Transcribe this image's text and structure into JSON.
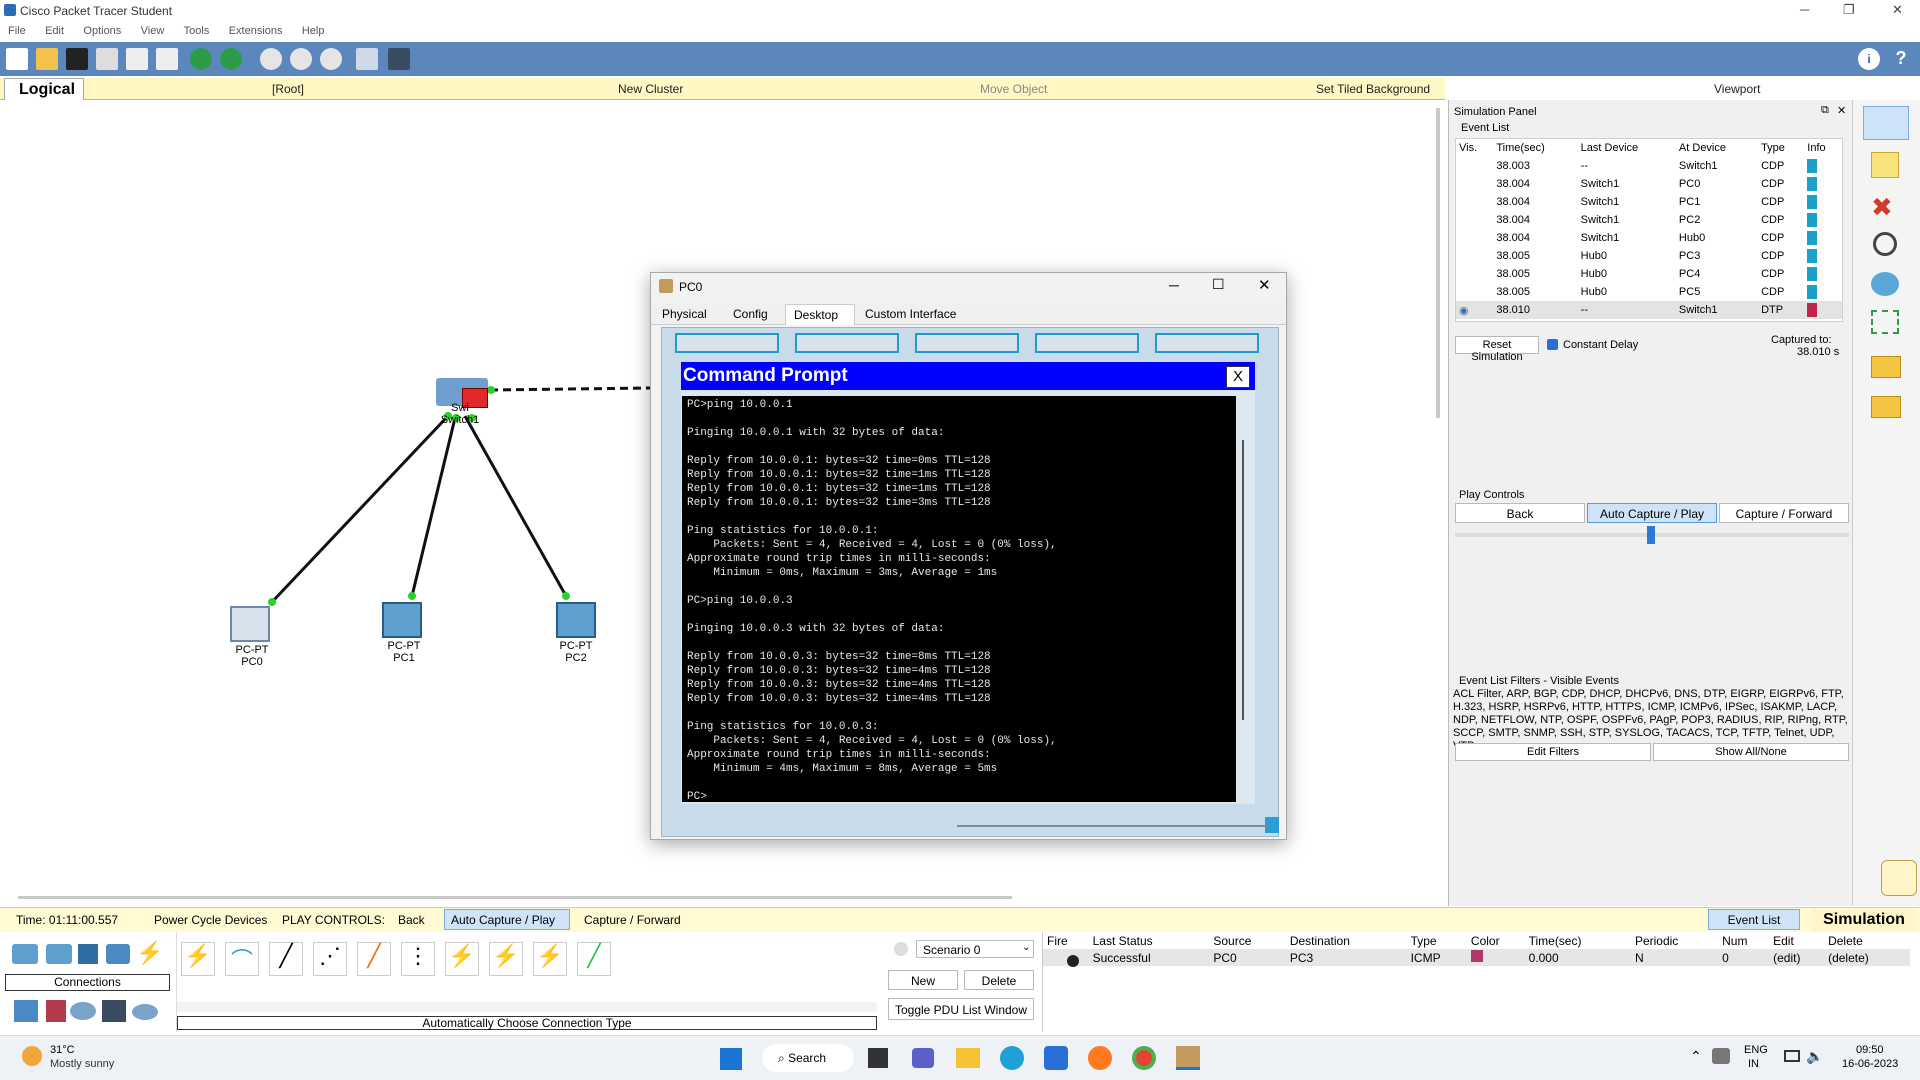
{
  "app": {
    "title": "Cisco Packet Tracer Student",
    "menu": [
      "File",
      "Edit",
      "Options",
      "View",
      "Tools",
      "Extensions",
      "Help"
    ]
  },
  "modebar": {
    "logical": "Logical",
    "root": "[Root]",
    "new_cluster": "New Cluster",
    "move_object": "Move Object",
    "set_tiled_background": "Set Tiled Background",
    "viewport": "Viewport"
  },
  "devices": [
    {
      "name": "PC0",
      "type": "PC-PT"
    },
    {
      "name": "PC1",
      "type": "PC-PT"
    },
    {
      "name": "PC2",
      "type": "PC-PT"
    }
  ],
  "switch": {
    "label_a": "Swi",
    "label_b": "Switch1"
  },
  "pc_window": {
    "title": "PC0",
    "tabs": [
      "Physical",
      "Config",
      "Desktop",
      "Custom Interface"
    ],
    "active_tab": "Desktop"
  },
  "command_prompt": {
    "title": "Command Prompt",
    "close": "X",
    "lines": [
      "PC>ping 10.0.0.1",
      "",
      "Pinging 10.0.0.1 with 32 bytes of data:",
      "",
      "Reply from 10.0.0.1: bytes=32 time=0ms TTL=128",
      "Reply from 10.0.0.1: bytes=32 time=1ms TTL=128",
      "Reply from 10.0.0.1: bytes=32 time=1ms TTL=128",
      "Reply from 10.0.0.1: bytes=32 time=3ms TTL=128",
      "",
      "Ping statistics for 10.0.0.1:",
      "    Packets: Sent = 4, Received = 4, Lost = 0 (0% loss),",
      "Approximate round trip times in milli-seconds:",
      "    Minimum = 0ms, Maximum = 3ms, Average = 1ms",
      "",
      "PC>ping 10.0.0.3",
      "",
      "Pinging 10.0.0.3 with 32 bytes of data:",
      "",
      "Reply from 10.0.0.3: bytes=32 time=8ms TTL=128",
      "Reply from 10.0.0.3: bytes=32 time=4ms TTL=128",
      "Reply from 10.0.0.3: bytes=32 time=4ms TTL=128",
      "Reply from 10.0.0.3: bytes=32 time=4ms TTL=128",
      "",
      "Ping statistics for 10.0.0.3:",
      "    Packets: Sent = 4, Received = 4, Lost = 0 (0% loss),",
      "Approximate round trip times in milli-seconds:",
      "    Minimum = 4ms, Maximum = 8ms, Average = 5ms",
      "",
      "PC>"
    ]
  },
  "simulation_panel": {
    "title": "Simulation Panel",
    "event_list": "Event List",
    "columns": [
      "Vis.",
      "Time(sec)",
      "Last Device",
      "At Device",
      "Type",
      "Info"
    ],
    "events": [
      {
        "time": "38.003",
        "last": "--",
        "at": "Switch1",
        "type": "CDP",
        "color": "#1e9fc6"
      },
      {
        "time": "38.004",
        "last": "Switch1",
        "at": "PC0",
        "type": "CDP",
        "color": "#1e9fc6"
      },
      {
        "time": "38.004",
        "last": "Switch1",
        "at": "PC1",
        "type": "CDP",
        "color": "#1e9fc6"
      },
      {
        "time": "38.004",
        "last": "Switch1",
        "at": "PC2",
        "type": "CDP",
        "color": "#1e9fc6"
      },
      {
        "time": "38.004",
        "last": "Switch1",
        "at": "Hub0",
        "type": "CDP",
        "color": "#1e9fc6"
      },
      {
        "time": "38.005",
        "last": "Hub0",
        "at": "PC3",
        "type": "CDP",
        "color": "#1e9fc6"
      },
      {
        "time": "38.005",
        "last": "Hub0",
        "at": "PC4",
        "type": "CDP",
        "color": "#1e9fc6"
      },
      {
        "time": "38.005",
        "last": "Hub0",
        "at": "PC5",
        "type": "CDP",
        "color": "#1e9fc6"
      },
      {
        "time": "38.010",
        "last": "--",
        "at": "Switch1",
        "type": "DTP",
        "color": "#c0274a"
      }
    ],
    "reset_simulation": "Reset Simulation",
    "constant_delay": "Constant Delay",
    "captured_label": "Captured to:",
    "captured_value": "38.010 s",
    "play_controls": "Play Controls",
    "back": "Back",
    "auto_capture_play": "Auto Capture / Play",
    "capture_forward": "Capture / Forward",
    "filters_title": "Event List Filters - Visible Events",
    "filters_text": "ACL Filter, ARP, BGP, CDP, DHCP, DHCPv6, DNS, DTP, EIGRP, EIGRPv6, FTP, H.323, HSRP, HSRPv6, HTTP, HTTPS, ICMP, ICMPv6, IPSec, ISAKMP, LACP, NDP, NETFLOW, NTP, OSPF, OSPFv6, PAgP, POP3, RADIUS, RIP, RIPng, RTP, SCCP, SMTP, SNMP, SSH, STP, SYSLOG, TACACS, TCP, TFTP, Telnet, UDP, VTP",
    "edit_filters": "Edit Filters",
    "show_all_none": "Show All/None"
  },
  "status": {
    "time": "Time: 01:11:00.557",
    "power_cycle": "Power Cycle Devices",
    "play_controls": "PLAY CONTROLS:",
    "back": "Back",
    "auto_capture_play": "Auto Capture / Play",
    "capture_forward": "Capture / Forward",
    "event_list": "Event List",
    "simulation": "Simulation"
  },
  "bottom": {
    "connections": "Connections",
    "auto_connection": "Automatically Choose Connection Type",
    "scenario": "Scenario 0",
    "new": "New",
    "delete": "Delete",
    "toggle_pdu": "Toggle PDU List Window",
    "pdu_columns": [
      "Fire",
      "Last Status",
      "Source",
      "Destination",
      "Type",
      "Color",
      "Time(sec)",
      "Periodic",
      "Num",
      "Edit",
      "Delete"
    ],
    "pdu_row": {
      "status": "Successful",
      "source": "PC0",
      "destination": "PC3",
      "type": "ICMP",
      "color": "#b03a6a",
      "time": "0.000",
      "periodic": "N",
      "num": "0",
      "edit": "(edit)",
      "delete": "(delete)"
    }
  },
  "taskbar": {
    "temp": "31°C",
    "weather": "Mostly sunny",
    "search": "Search",
    "lang1": "ENG",
    "lang2": "IN",
    "time": "09:50",
    "date": "16-06-2023"
  }
}
